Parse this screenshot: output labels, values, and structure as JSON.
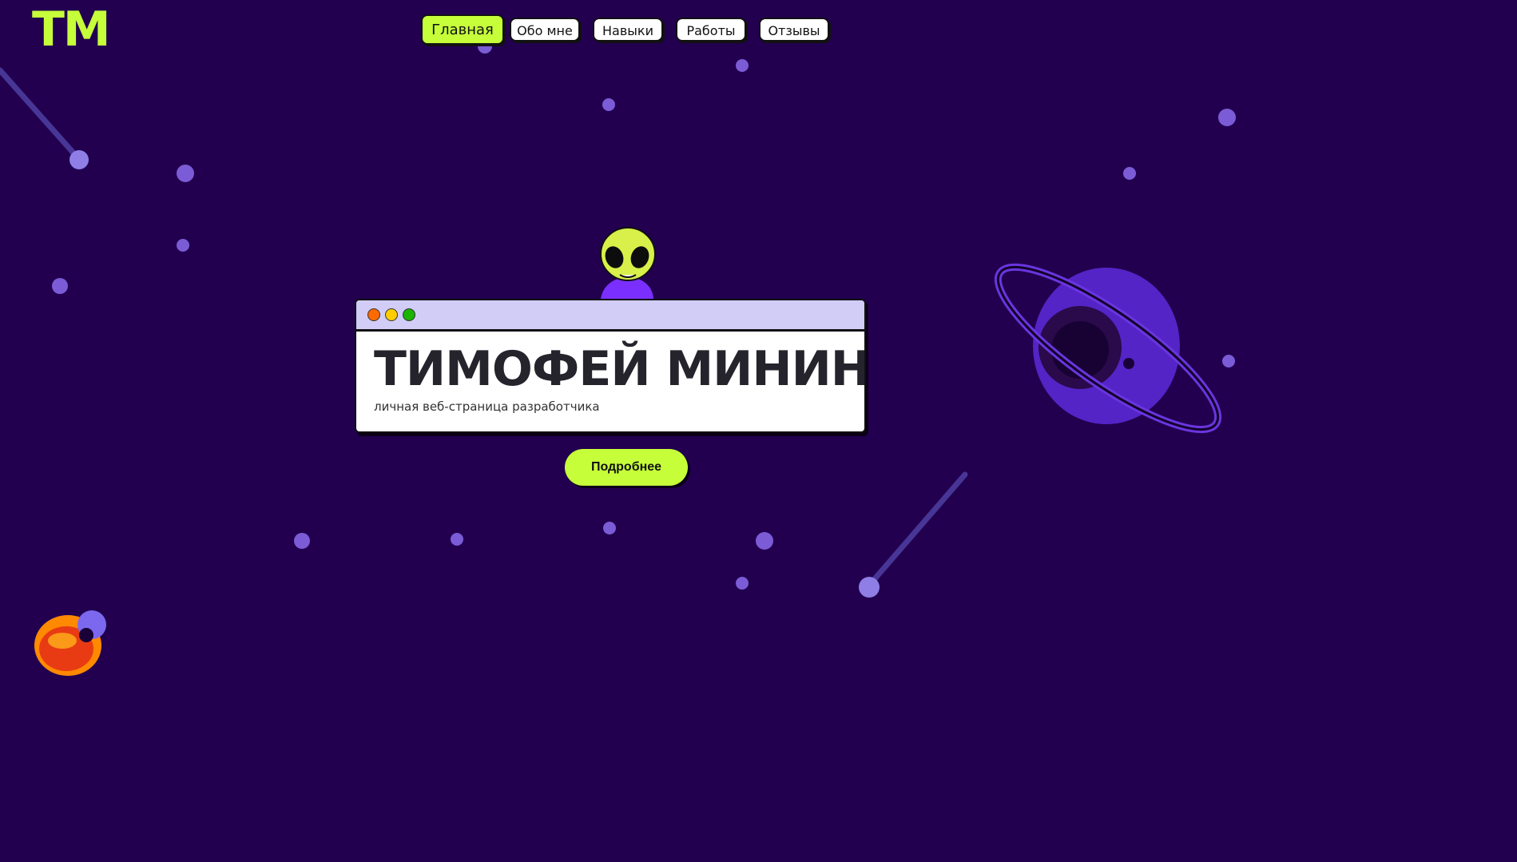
{
  "header": {
    "logo": "ТМ"
  },
  "nav": {
    "items": [
      {
        "label": "Главная",
        "active": true
      },
      {
        "label": "Обо мне",
        "active": false
      },
      {
        "label": "Навыки",
        "active": false
      },
      {
        "label": "Работы",
        "active": false
      },
      {
        "label": "Отзывы",
        "active": false
      }
    ]
  },
  "hero": {
    "title": "ТИМОФЕЙ МИНИН",
    "subtitle": "личная веб-страница разработчика",
    "cta_label": "Подробнее",
    "window_controls": [
      "close-dot",
      "minimize-dot",
      "maximize-dot"
    ]
  },
  "decor": {
    "mascot": "alien-mascot-icon",
    "planet": "ringed-planet-icon",
    "bottom_planet": "lava-planet-icon",
    "meteors": "comet-icon",
    "stars": "star-dot-icon"
  },
  "colors": {
    "background": "#22004f",
    "accent": "#c6ff3a",
    "window_bar": "#d2cdf7",
    "star": "#7b5cd6",
    "dot_close": "#ff6a00",
    "dot_minimize": "#ffcc00",
    "dot_maximize": "#1bb400"
  }
}
